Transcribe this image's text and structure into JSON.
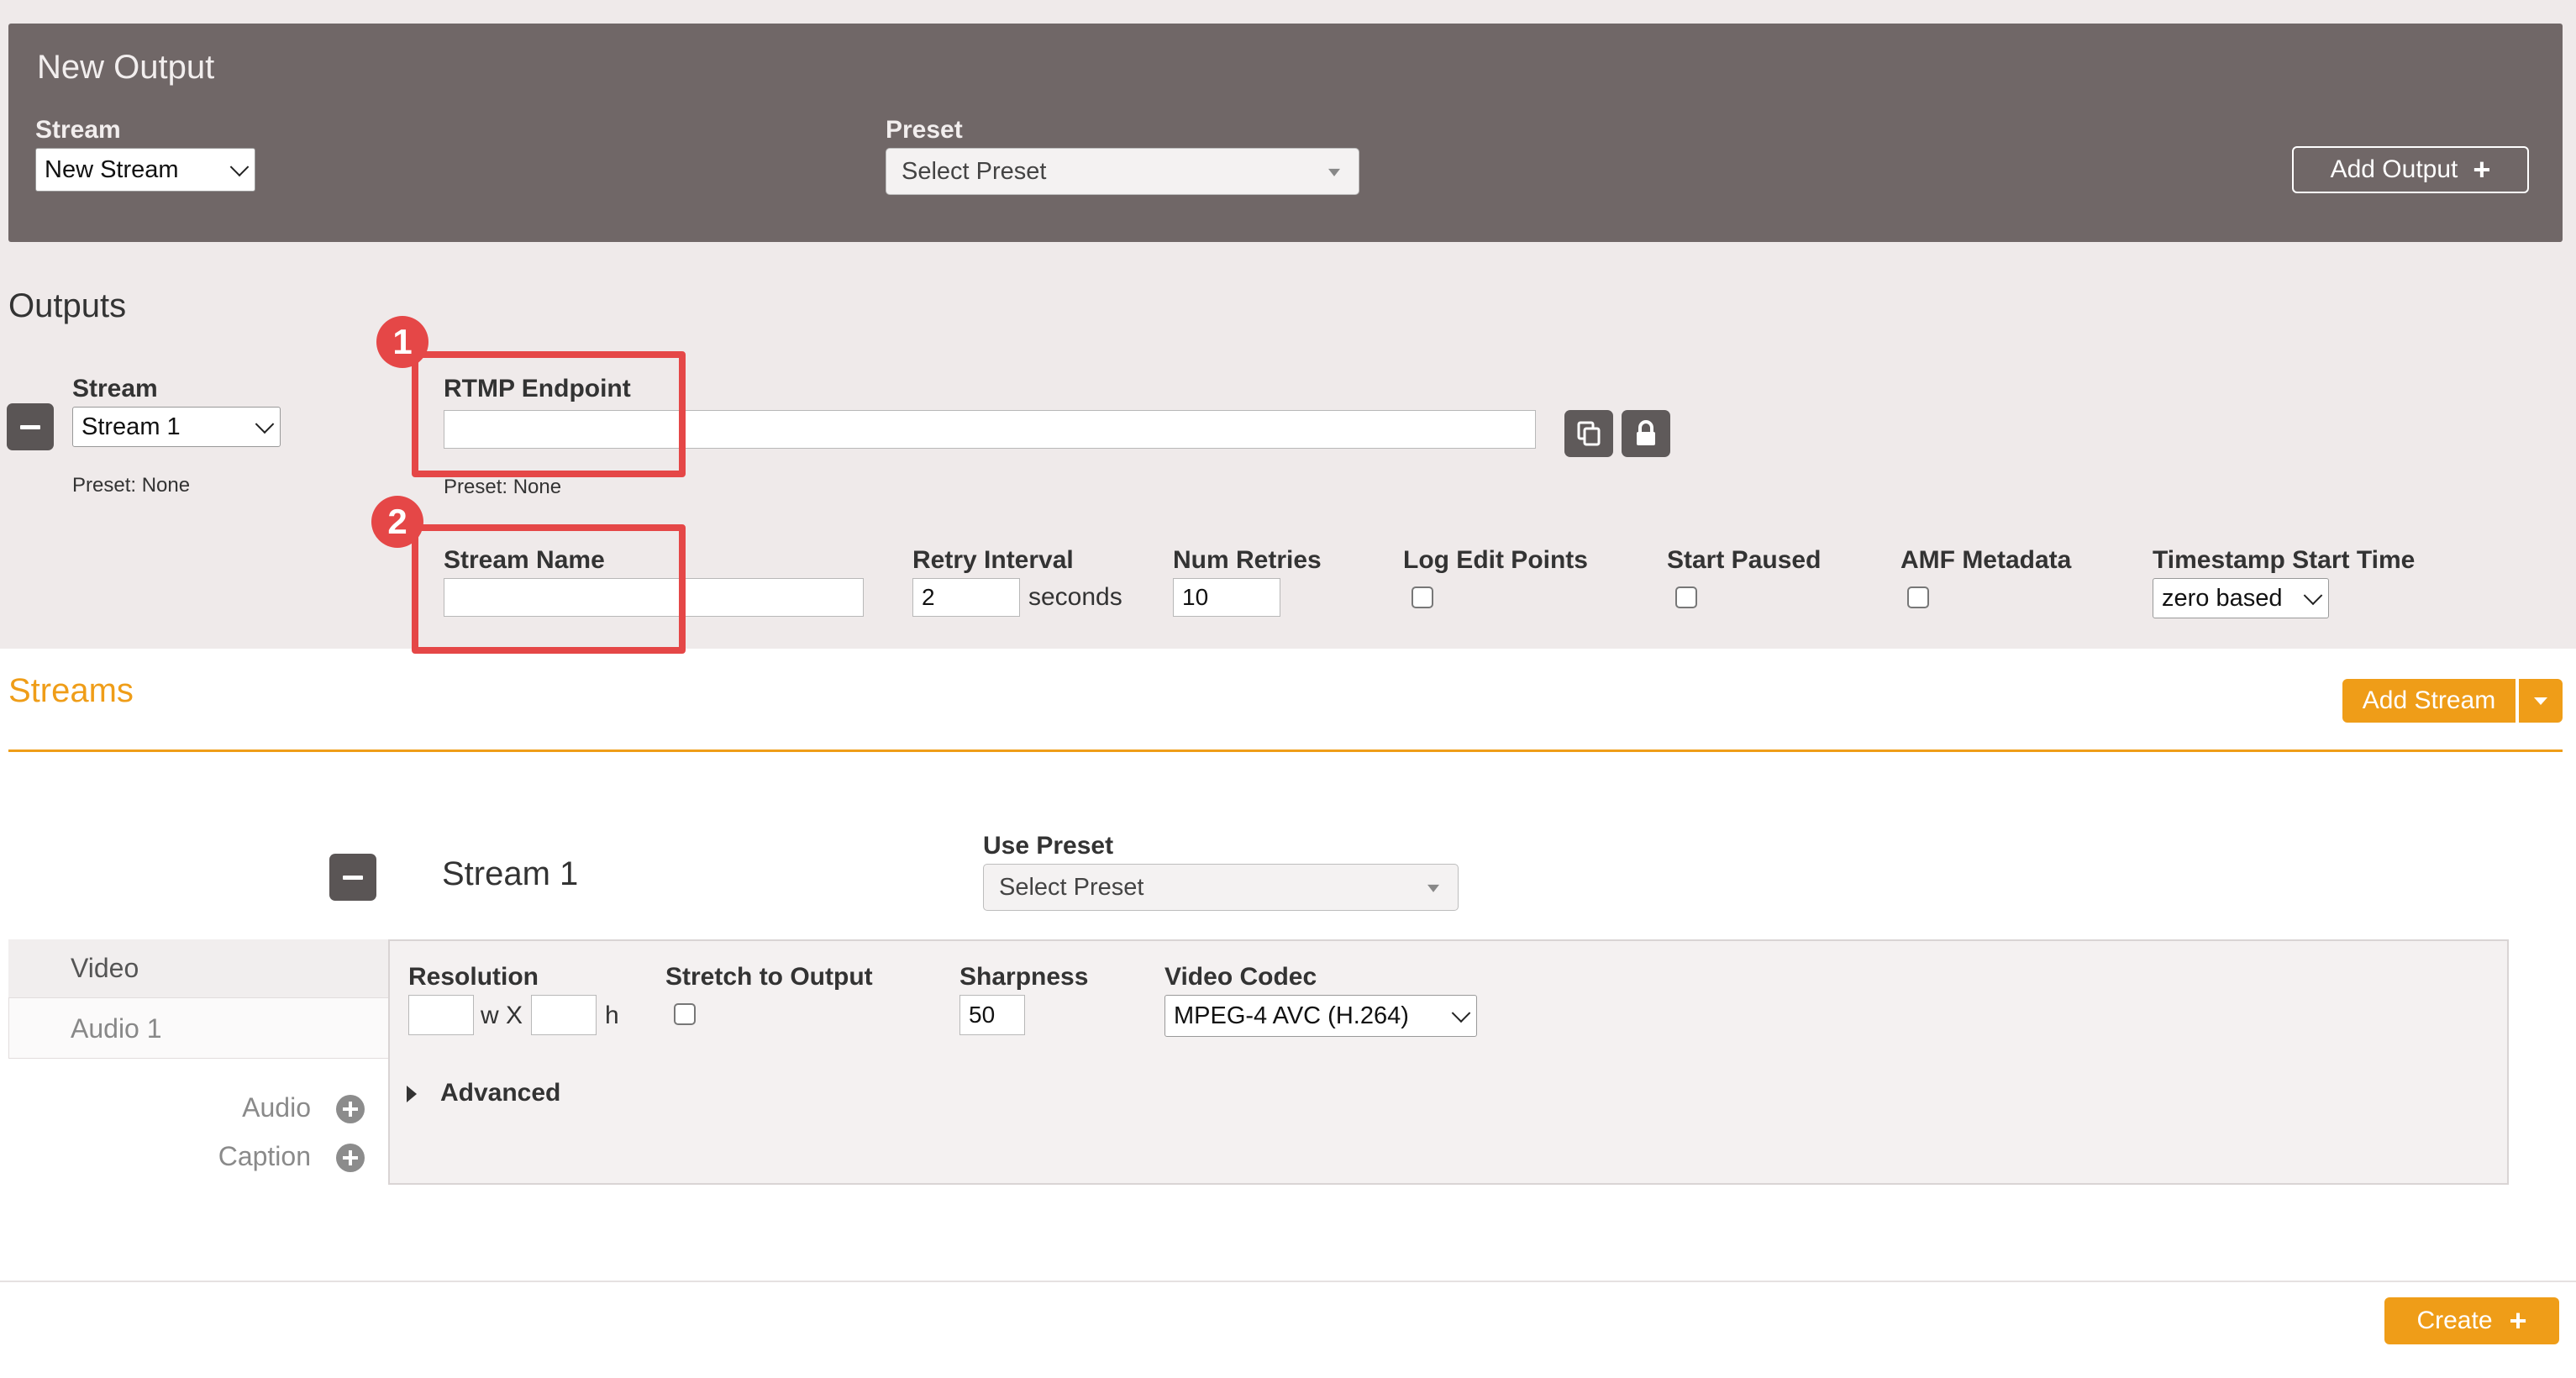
{
  "new_output": {
    "title": "New Output",
    "stream_label": "Stream",
    "stream_value": "New Stream",
    "preset_label": "Preset",
    "preset_value": "Select Preset",
    "add_output_label": "Add Output"
  },
  "outputs": {
    "title": "Outputs",
    "stream_label": "Stream",
    "stream_value": "Stream 1",
    "stream_preset_text": "Preset: None",
    "rtmp_endpoint_label": "RTMP Endpoint",
    "rtmp_endpoint_value": "",
    "rtmp_preset_text": "Preset: None",
    "stream_name_label": "Stream Name",
    "stream_name_value": "",
    "retry_interval_label": "Retry Interval",
    "retry_interval_value": "2",
    "retry_interval_unit": "seconds",
    "num_retries_label": "Num Retries",
    "num_retries_value": "10",
    "log_edit_points_label": "Log Edit Points",
    "start_paused_label": "Start Paused",
    "amf_metadata_label": "AMF Metadata",
    "timestamp_start_label": "Timestamp Start Time",
    "timestamp_start_value": "zero based"
  },
  "annotations": [
    "1",
    "2"
  ],
  "streams": {
    "title": "Streams",
    "add_stream_label": "Add Stream",
    "stream_title": "Stream 1",
    "use_preset_label": "Use Preset",
    "use_preset_value": "Select Preset",
    "tabs": [
      "Video",
      "Audio 1"
    ],
    "add_audio_label": "Audio",
    "add_caption_label": "Caption",
    "video": {
      "resolution_label": "Resolution",
      "width_value": "",
      "height_value": "",
      "wx_text": "w X",
      "h_text": "h",
      "stretch_label": "Stretch to Output",
      "sharpness_label": "Sharpness",
      "sharpness_value": "50",
      "codec_label": "Video Codec",
      "codec_value": "MPEG-4 AVC (H.264)",
      "advanced_label": "Advanced"
    }
  },
  "footer": {
    "create_label": "Create"
  },
  "colors": {
    "header_bg": "#706767",
    "outputs_bg": "#efeaea",
    "accent_orange": "#ef9d18",
    "annotation_red": "#e54747"
  }
}
